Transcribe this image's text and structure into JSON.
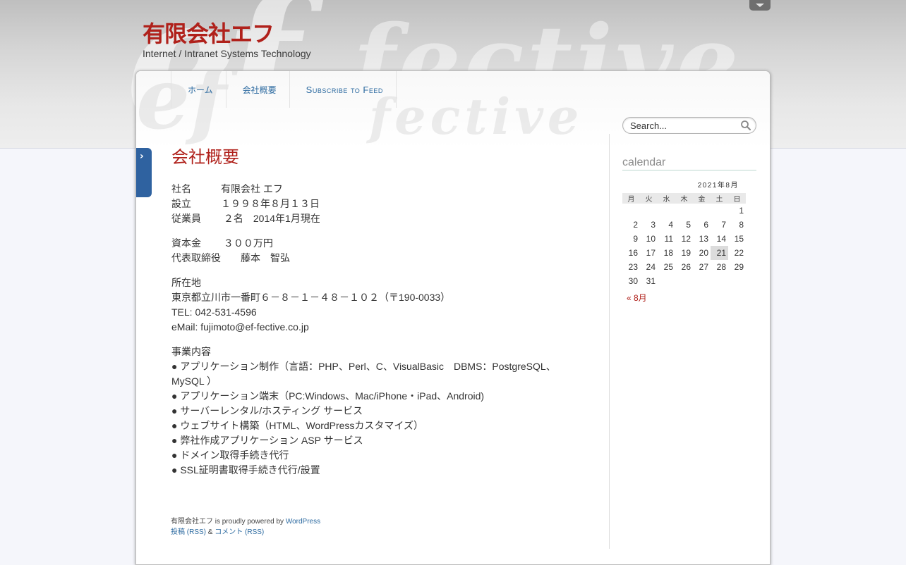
{
  "site": {
    "title": "有限会社エフ",
    "description": "Internet / Intranet Systems Technology"
  },
  "nav": {
    "items": [
      {
        "label": "ホーム"
      },
      {
        "label": "会社概要"
      },
      {
        "label": "Subscribe to Feed"
      }
    ]
  },
  "search": {
    "value": "Search..."
  },
  "side_tab": {
    "glyph": "›"
  },
  "page": {
    "title": "会社概要",
    "company_name": "社名　　　有限会社 エフ",
    "founded": "設立　　　１９９８年８月１３日",
    "employees": "従業員　　 ２名　2014年1月現在",
    "capital": "資本金　　 ３００万円",
    "representative": "代表取締役　　藤本　智弘",
    "address_label": "所在地",
    "address": "東京都立川市一番町６－８－１－４８－１０２（〒190-0033）",
    "tel": "TEL: 042-531-4596",
    "email": "eMail: fujimoto@ef-fective.co.jp",
    "business_label": "事業内容",
    "business_items": [
      "● アプリケーション制作（言語：PHP、Perl、C、VisualBasic　DBMS：PostgreSQL、MySQL ）",
      "● アプリケーション端末（PC:Windows、Mac/iPhone・iPad、Android)",
      "● サーバーレンタル/ホスティング サービス",
      "● ウェブサイト構築（HTML、WordPressカスタマイズ）",
      "● 弊社作成アプリケーション ASP サービス",
      "● ドメイン取得手続き代行",
      "● SSL証明書取得手続き代行/設置"
    ]
  },
  "footer": {
    "site": "有限会社エフ",
    "powered": " is proudly powered by ",
    "wordpress": "WordPress",
    "posts_rss": "投稿 (RSS)",
    "amp": " & ",
    "comments_rss": "コメント (RSS)"
  },
  "calendar": {
    "heading": "calendar",
    "caption": "2021年8月",
    "weekdays": [
      "月",
      "火",
      "水",
      "木",
      "金",
      "土",
      "日"
    ],
    "weeks": [
      [
        "",
        "",
        "",
        "",
        "",
        "",
        "1"
      ],
      [
        "2",
        "3",
        "4",
        "5",
        "6",
        "7",
        "8"
      ],
      [
        "9",
        "10",
        "11",
        "12",
        "13",
        "14",
        "15"
      ],
      [
        "16",
        "17",
        "18",
        "19",
        "20",
        "21",
        "22"
      ],
      [
        "23",
        "24",
        "25",
        "26",
        "27",
        "28",
        "29"
      ],
      [
        "30",
        "31",
        "",
        "",
        "",
        "",
        ""
      ]
    ],
    "today": "21",
    "prev_label": "« 8月"
  },
  "colors": {
    "accent_red": "#b0211b",
    "link_blue": "#2c6aa0",
    "side_tab_blue": "#2f62a0"
  },
  "icons": {
    "search": "search-icon",
    "menu_toggle": "chevron-down-icon",
    "side_tab": "chevron-right-icon"
  }
}
